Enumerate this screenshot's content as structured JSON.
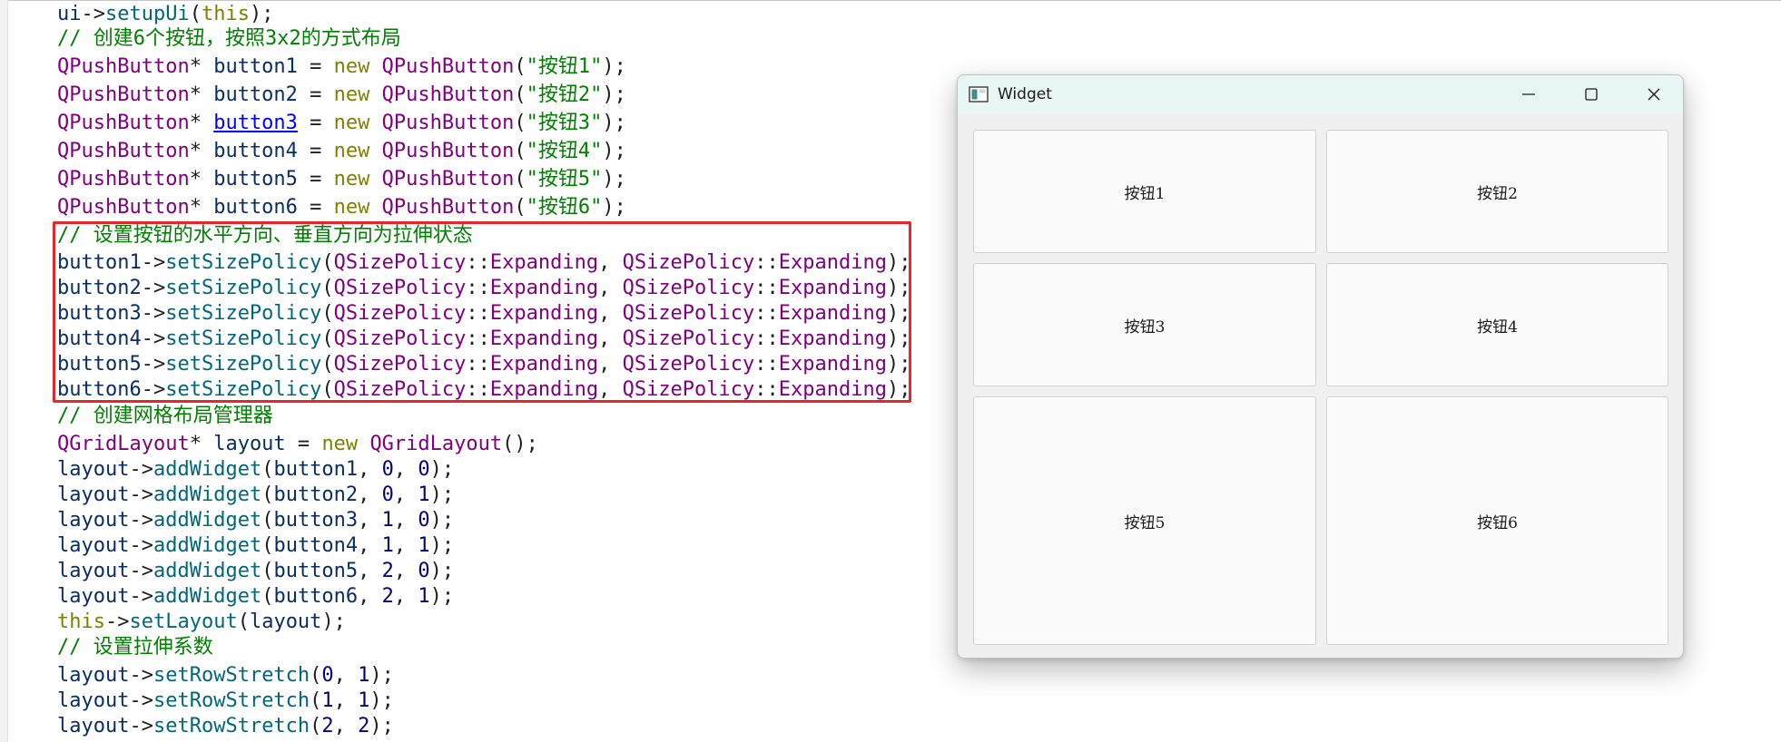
{
  "code": {
    "lines": [
      [
        [
          "v",
          "ui"
        ],
        [
          "o",
          "->"
        ],
        [
          "f",
          "setupUi"
        ],
        [
          "o",
          "("
        ],
        [
          "k",
          "this"
        ],
        [
          "o",
          ");"
        ]
      ],
      [
        [
          "c",
          "// 创建6个按钮，按照3x2的方式布局"
        ]
      ],
      [
        [
          "t",
          "QPushButton"
        ],
        [
          "o",
          "* "
        ],
        [
          "v",
          "button1"
        ],
        [
          "o",
          " = "
        ],
        [
          "k",
          "new"
        ],
        [
          "o",
          " "
        ],
        [
          "t",
          "QPushButton"
        ],
        [
          "o",
          "("
        ],
        [
          "s",
          "\"按钮1\""
        ],
        [
          "o",
          ");"
        ]
      ],
      [
        [
          "t",
          "QPushButton"
        ],
        [
          "o",
          "* "
        ],
        [
          "v",
          "button2"
        ],
        [
          "o",
          " = "
        ],
        [
          "k",
          "new"
        ],
        [
          "o",
          " "
        ],
        [
          "t",
          "QPushButton"
        ],
        [
          "o",
          "("
        ],
        [
          "s",
          "\"按钮2\""
        ],
        [
          "o",
          ");"
        ]
      ],
      [
        [
          "t",
          "QPushButton"
        ],
        [
          "o",
          "* "
        ],
        [
          "lnk",
          "button3"
        ],
        [
          "o",
          " = "
        ],
        [
          "k",
          "new"
        ],
        [
          "o",
          " "
        ],
        [
          "t",
          "QPushButton"
        ],
        [
          "o",
          "("
        ],
        [
          "s",
          "\"按钮3\""
        ],
        [
          "o",
          ");"
        ]
      ],
      [
        [
          "t",
          "QPushButton"
        ],
        [
          "o",
          "* "
        ],
        [
          "v",
          "button4"
        ],
        [
          "o",
          " = "
        ],
        [
          "k",
          "new"
        ],
        [
          "o",
          " "
        ],
        [
          "t",
          "QPushButton"
        ],
        [
          "o",
          "("
        ],
        [
          "s",
          "\"按钮4\""
        ],
        [
          "o",
          ");"
        ]
      ],
      [
        [
          "t",
          "QPushButton"
        ],
        [
          "o",
          "* "
        ],
        [
          "v",
          "button5"
        ],
        [
          "o",
          " = "
        ],
        [
          "k",
          "new"
        ],
        [
          "o",
          " "
        ],
        [
          "t",
          "QPushButton"
        ],
        [
          "o",
          "("
        ],
        [
          "s",
          "\"按钮5\""
        ],
        [
          "o",
          ");"
        ]
      ],
      [
        [
          "t",
          "QPushButton"
        ],
        [
          "o",
          "* "
        ],
        [
          "v",
          "button6"
        ],
        [
          "o",
          " = "
        ],
        [
          "k",
          "new"
        ],
        [
          "o",
          " "
        ],
        [
          "t",
          "QPushButton"
        ],
        [
          "o",
          "("
        ],
        [
          "s",
          "\"按钮6\""
        ],
        [
          "o",
          ");"
        ]
      ],
      [
        [
          "c",
          "// 设置按钮的水平方向、垂直方向为拉伸状态"
        ]
      ],
      [
        [
          "v",
          "button1"
        ],
        [
          "o",
          "->"
        ],
        [
          "f",
          "setSizePolicy"
        ],
        [
          "o",
          "("
        ],
        [
          "t",
          "QSizePolicy"
        ],
        [
          "o",
          "::"
        ],
        [
          "e",
          "Expanding"
        ],
        [
          "o",
          ", "
        ],
        [
          "t",
          "QSizePolicy"
        ],
        [
          "o",
          "::"
        ],
        [
          "e",
          "Expanding"
        ],
        [
          "o",
          ");"
        ]
      ],
      [
        [
          "v",
          "button2"
        ],
        [
          "o",
          "->"
        ],
        [
          "f",
          "setSizePolicy"
        ],
        [
          "o",
          "("
        ],
        [
          "t",
          "QSizePolicy"
        ],
        [
          "o",
          "::"
        ],
        [
          "e",
          "Expanding"
        ],
        [
          "o",
          ", "
        ],
        [
          "t",
          "QSizePolicy"
        ],
        [
          "o",
          "::"
        ],
        [
          "e",
          "Expanding"
        ],
        [
          "o",
          ");"
        ]
      ],
      [
        [
          "v",
          "button3"
        ],
        [
          "o",
          "->"
        ],
        [
          "f",
          "setSizePolicy"
        ],
        [
          "o",
          "("
        ],
        [
          "t",
          "QSizePolicy"
        ],
        [
          "o",
          "::"
        ],
        [
          "e",
          "Expanding"
        ],
        [
          "o",
          ", "
        ],
        [
          "t",
          "QSizePolicy"
        ],
        [
          "o",
          "::"
        ],
        [
          "e",
          "Expanding"
        ],
        [
          "o",
          ");"
        ]
      ],
      [
        [
          "v",
          "button4"
        ],
        [
          "o",
          "->"
        ],
        [
          "f",
          "setSizePolicy"
        ],
        [
          "o",
          "("
        ],
        [
          "t",
          "QSizePolicy"
        ],
        [
          "o",
          "::"
        ],
        [
          "e",
          "Expanding"
        ],
        [
          "o",
          ", "
        ],
        [
          "t",
          "QSizePolicy"
        ],
        [
          "o",
          "::"
        ],
        [
          "e",
          "Expanding"
        ],
        [
          "o",
          ");"
        ]
      ],
      [
        [
          "v",
          "button5"
        ],
        [
          "o",
          "->"
        ],
        [
          "f",
          "setSizePolicy"
        ],
        [
          "o",
          "("
        ],
        [
          "t",
          "QSizePolicy"
        ],
        [
          "o",
          "::"
        ],
        [
          "e",
          "Expanding"
        ],
        [
          "o",
          ", "
        ],
        [
          "t",
          "QSizePolicy"
        ],
        [
          "o",
          "::"
        ],
        [
          "e",
          "Expanding"
        ],
        [
          "o",
          ");"
        ]
      ],
      [
        [
          "v",
          "button6"
        ],
        [
          "o",
          "->"
        ],
        [
          "f",
          "setSizePolicy"
        ],
        [
          "o",
          "("
        ],
        [
          "t",
          "QSizePolicy"
        ],
        [
          "o",
          "::"
        ],
        [
          "e",
          "Expanding"
        ],
        [
          "o",
          ", "
        ],
        [
          "t",
          "QSizePolicy"
        ],
        [
          "o",
          "::"
        ],
        [
          "e",
          "Expanding"
        ],
        [
          "o",
          ");"
        ]
      ],
      [
        [
          "c",
          "// 创建网格布局管理器"
        ]
      ],
      [
        [
          "t",
          "QGridLayout"
        ],
        [
          "o",
          "* "
        ],
        [
          "v",
          "layout"
        ],
        [
          "o",
          " = "
        ],
        [
          "k",
          "new"
        ],
        [
          "o",
          " "
        ],
        [
          "t",
          "QGridLayout"
        ],
        [
          "o",
          "();"
        ]
      ],
      [
        [
          "v",
          "layout"
        ],
        [
          "o",
          "->"
        ],
        [
          "f",
          "addWidget"
        ],
        [
          "o",
          "("
        ],
        [
          "v",
          "button1"
        ],
        [
          "o",
          ", "
        ],
        [
          "n",
          "0"
        ],
        [
          "o",
          ", "
        ],
        [
          "n",
          "0"
        ],
        [
          "o",
          ");"
        ]
      ],
      [
        [
          "v",
          "layout"
        ],
        [
          "o",
          "->"
        ],
        [
          "f",
          "addWidget"
        ],
        [
          "o",
          "("
        ],
        [
          "v",
          "button2"
        ],
        [
          "o",
          ", "
        ],
        [
          "n",
          "0"
        ],
        [
          "o",
          ", "
        ],
        [
          "n",
          "1"
        ],
        [
          "o",
          ");"
        ]
      ],
      [
        [
          "v",
          "layout"
        ],
        [
          "o",
          "->"
        ],
        [
          "f",
          "addWidget"
        ],
        [
          "o",
          "("
        ],
        [
          "v",
          "button3"
        ],
        [
          "o",
          ", "
        ],
        [
          "n",
          "1"
        ],
        [
          "o",
          ", "
        ],
        [
          "n",
          "0"
        ],
        [
          "o",
          ");"
        ]
      ],
      [
        [
          "v",
          "layout"
        ],
        [
          "o",
          "->"
        ],
        [
          "f",
          "addWidget"
        ],
        [
          "o",
          "("
        ],
        [
          "v",
          "button4"
        ],
        [
          "o",
          ", "
        ],
        [
          "n",
          "1"
        ],
        [
          "o",
          ", "
        ],
        [
          "n",
          "1"
        ],
        [
          "o",
          ");"
        ]
      ],
      [
        [
          "v",
          "layout"
        ],
        [
          "o",
          "->"
        ],
        [
          "f",
          "addWidget"
        ],
        [
          "o",
          "("
        ],
        [
          "v",
          "button5"
        ],
        [
          "o",
          ", "
        ],
        [
          "n",
          "2"
        ],
        [
          "o",
          ", "
        ],
        [
          "n",
          "0"
        ],
        [
          "o",
          ");"
        ]
      ],
      [
        [
          "v",
          "layout"
        ],
        [
          "o",
          "->"
        ],
        [
          "f",
          "addWidget"
        ],
        [
          "o",
          "("
        ],
        [
          "v",
          "button6"
        ],
        [
          "o",
          ", "
        ],
        [
          "n",
          "2"
        ],
        [
          "o",
          ", "
        ],
        [
          "n",
          "1"
        ],
        [
          "o",
          ");"
        ]
      ],
      [
        [
          "k",
          "this"
        ],
        [
          "o",
          "->"
        ],
        [
          "f",
          "setLayout"
        ],
        [
          "o",
          "("
        ],
        [
          "v",
          "layout"
        ],
        [
          "o",
          ");"
        ]
      ],
      [
        [
          "c",
          "// 设置拉伸系数"
        ]
      ],
      [
        [
          "v",
          "layout"
        ],
        [
          "o",
          "->"
        ],
        [
          "f",
          "setRowStretch"
        ],
        [
          "o",
          "("
        ],
        [
          "n",
          "0"
        ],
        [
          "o",
          ", "
        ],
        [
          "n",
          "1"
        ],
        [
          "o",
          ");"
        ]
      ],
      [
        [
          "v",
          "layout"
        ],
        [
          "o",
          "->"
        ],
        [
          "f",
          "setRowStretch"
        ],
        [
          "o",
          "("
        ],
        [
          "n",
          "1"
        ],
        [
          "o",
          ", "
        ],
        [
          "n",
          "1"
        ],
        [
          "o",
          ");"
        ]
      ],
      [
        [
          "v",
          "layout"
        ],
        [
          "o",
          "->"
        ],
        [
          "f",
          "setRowStretch"
        ],
        [
          "o",
          "("
        ],
        [
          "n",
          "2"
        ],
        [
          "o",
          ", "
        ],
        [
          "n",
          "2"
        ],
        [
          "o",
          ");"
        ]
      ]
    ]
  },
  "window": {
    "title": "Widget",
    "icon": "qt-widget-icon",
    "buttons": [
      "按钮1",
      "按钮2",
      "按钮3",
      "按钮4",
      "按钮5",
      "按钮6"
    ],
    "controls": [
      "minimize-icon",
      "maximize-icon",
      "close-icon"
    ]
  },
  "colors": {
    "keyword": "#808000",
    "type": "#800080",
    "function": "#00677c",
    "string": "#008000",
    "comment": "#008000",
    "highlight_border": "#e8262a",
    "titlebar": "#e8f6f5"
  }
}
